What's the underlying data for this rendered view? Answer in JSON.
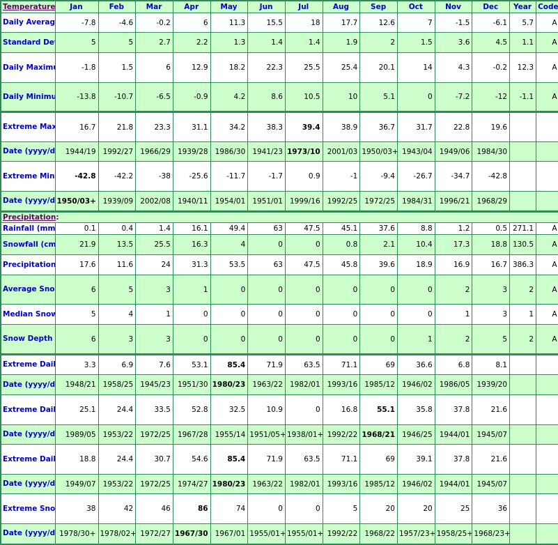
{
  "header": {
    "section_label": "Temperature",
    "section_suffix": ":",
    "months": [
      "Jan",
      "Feb",
      "Mar",
      "Apr",
      "May",
      "Jun",
      "Jul",
      "Aug",
      "Sep",
      "Oct",
      "Nov",
      "Dec"
    ],
    "year": "Year",
    "code": "Code"
  },
  "colors": {
    "border": "#2e8b57",
    "green_row": "#ccffcc",
    "label_text": "#0000cc",
    "section_text": "#660066"
  },
  "temperature": {
    "rows": [
      {
        "label": "Daily Average (°C)",
        "values": [
          "-7.8",
          "-4.6",
          "-0.2",
          "6",
          "11.3",
          "15.5",
          "18",
          "17.7",
          "12.6",
          "7",
          "-1.5",
          "-6.1"
        ],
        "year": "5.7",
        "code": "A",
        "bold": []
      },
      {
        "label": "Standard Deviation",
        "values": [
          "5",
          "5",
          "2.7",
          "2.2",
          "1.3",
          "1.4",
          "1.4",
          "1.9",
          "2",
          "1.5",
          "3.6",
          "4.5"
        ],
        "year": "1.1",
        "code": "A",
        "bold": []
      },
      {
        "label": "Daily Maximum (°C)",
        "values": [
          "-1.8",
          "1.5",
          "6",
          "12.9",
          "18.2",
          "22.3",
          "25.5",
          "25.4",
          "20.1",
          "14",
          "4.3",
          "-0.2"
        ],
        "year": "12.3",
        "code": "A",
        "bold": []
      },
      {
        "label": "Daily Minimum (°C)",
        "values": [
          "-13.8",
          "-10.7",
          "-6.5",
          "-0.9",
          "4.2",
          "8.6",
          "10.5",
          "10",
          "5.1",
          "0",
          "-7.2",
          "-12"
        ],
        "year": "-1.1",
        "code": "A",
        "bold": []
      },
      {
        "label": "Extreme Maximum (°C)",
        "values": [
          "16.7",
          "21.8",
          "23.3",
          "31.1",
          "34.2",
          "38.3",
          "39.4",
          "38.9",
          "36.7",
          "31.7",
          "22.8",
          "19.6"
        ],
        "year": "",
        "code": "",
        "bold": [
          6
        ]
      },
      {
        "label": "Date (yyyy/dd)",
        "values": [
          "1944/19",
          "1992/27",
          "1966/29",
          "1939/28",
          "1986/30",
          "1941/23",
          "1973/10",
          "2001/03",
          "1950/03+",
          "1943/04",
          "1949/06",
          "1984/30"
        ],
        "year": "",
        "code": "",
        "bold": [
          6
        ]
      },
      {
        "label": "Extreme Minimum (°C)",
        "values": [
          "-42.8",
          "-42.2",
          "-38",
          "-25.6",
          "-11.7",
          "-1.7",
          "0.9",
          "-1",
          "-9.4",
          "-26.7",
          "-34.7",
          "-42.8"
        ],
        "year": "",
        "code": "",
        "bold": [
          0
        ]
      },
      {
        "label": "Date (yyyy/dd)",
        "values": [
          "1950/03+",
          "1939/09",
          "2002/08",
          "1940/11",
          "1954/01",
          "1951/01",
          "1999/16",
          "1992/25",
          "1972/25",
          "1984/31",
          "1996/21",
          "1968/29"
        ],
        "year": "",
        "code": "",
        "bold": [
          0
        ]
      }
    ]
  },
  "precipitation": {
    "section_label": "Precipitation",
    "section_suffix": ":",
    "rows": [
      {
        "label": "Rainfall (mm)",
        "values": [
          "0.1",
          "0.4",
          "1.4",
          "16.1",
          "49.4",
          "63",
          "47.5",
          "45.1",
          "37.6",
          "8.8",
          "1.2",
          "0.5"
        ],
        "year": "271.1",
        "code": "A",
        "bold": []
      },
      {
        "label": "Snowfall (cm)",
        "values": [
          "21.9",
          "13.5",
          "25.5",
          "16.3",
          "4",
          "0",
          "0",
          "0.8",
          "2.1",
          "10.4",
          "17.3",
          "18.8"
        ],
        "year": "130.5",
        "code": "A",
        "bold": []
      },
      {
        "label": "Precipitation (mm)",
        "values": [
          "17.6",
          "11.6",
          "24",
          "31.3",
          "53.5",
          "63",
          "47.5",
          "45.8",
          "39.6",
          "18.9",
          "16.9",
          "16.7"
        ],
        "year": "386.3",
        "code": "A",
        "bold": []
      },
      {
        "label": "Average Snow Depth (cm)",
        "values": [
          "6",
          "5",
          "3",
          "1",
          "0",
          "0",
          "0",
          "0",
          "0",
          "0",
          "2",
          "3"
        ],
        "year": "2",
        "code": "A",
        "bold": []
      },
      {
        "label": "Median Snow Depth (cm)",
        "values": [
          "5",
          "4",
          "1",
          "0",
          "0",
          "0",
          "0",
          "0",
          "0",
          "0",
          "1",
          "3"
        ],
        "year": "1",
        "code": "A",
        "bold": []
      },
      {
        "label": "Snow Depth at Month-end (cm)",
        "values": [
          "6",
          "3",
          "3",
          "0",
          "0",
          "0",
          "0",
          "0",
          "0",
          "1",
          "2",
          "5"
        ],
        "year": "2",
        "code": "A",
        "bold": []
      },
      {
        "label": "Extreme Daily Rainfall (mm)",
        "values": [
          "3.3",
          "6.9",
          "7.6",
          "53.1",
          "85.4",
          "71.9",
          "63.5",
          "71.1",
          "69",
          "36.6",
          "6.8",
          "8.1"
        ],
        "year": "",
        "code": "",
        "bold": [
          4
        ]
      },
      {
        "label": "Date (yyyy/dd)",
        "values": [
          "1948/21",
          "1958/25",
          "1945/23",
          "1951/30",
          "1980/23",
          "1963/22",
          "1982/01",
          "1993/16",
          "1985/12",
          "1946/02",
          "1986/05",
          "1939/20"
        ],
        "year": "",
        "code": "",
        "bold": [
          4
        ]
      },
      {
        "label": "Extreme Daily Snowfall (cm)",
        "values": [
          "25.1",
          "24.4",
          "33.5",
          "52.8",
          "32.5",
          "10.9",
          "0",
          "16.8",
          "55.1",
          "35.8",
          "37.8",
          "21.6"
        ],
        "year": "",
        "code": "",
        "bold": [
          8
        ]
      },
      {
        "label": "Date (yyyy/dd)",
        "values": [
          "1989/05",
          "1953/22",
          "1972/25",
          "1967/28",
          "1955/14",
          "1951/05+",
          "1938/01+",
          "1992/22",
          "1968/21",
          "1946/25",
          "1944/01",
          "1945/07"
        ],
        "year": "",
        "code": "",
        "bold": [
          8
        ]
      },
      {
        "label": "Extreme Daily Precipitation (mm)",
        "values": [
          "18.8",
          "24.4",
          "30.7",
          "54.6",
          "85.4",
          "71.9",
          "63.5",
          "71.1",
          "69",
          "39.1",
          "37.8",
          "21.6"
        ],
        "year": "",
        "code": "",
        "bold": [
          4
        ]
      },
      {
        "label": "Date (yyyy/dd)",
        "values": [
          "1949/07",
          "1953/22",
          "1972/25",
          "1974/27",
          "1980/23",
          "1963/22",
          "1982/01",
          "1993/16",
          "1985/12",
          "1946/02",
          "1944/01",
          "1945/07"
        ],
        "year": "",
        "code": "",
        "bold": [
          4
        ]
      },
      {
        "label": "Extreme Snow Depth (cm)",
        "values": [
          "38",
          "42",
          "46",
          "86",
          "74",
          "0",
          "0",
          "5",
          "20",
          "20",
          "25",
          "36"
        ],
        "year": "",
        "code": "",
        "bold": [
          3
        ]
      },
      {
        "label": "Date (yyyy/dd)",
        "values": [
          "1978/30+",
          "1978/02+",
          "1972/27",
          "1967/30",
          "1967/01",
          "1955/01+",
          "1955/01+",
          "1992/22",
          "1968/22",
          "1957/23+",
          "1958/25+",
          "1968/23+"
        ],
        "year": "",
        "code": "",
        "bold": [
          3
        ]
      }
    ]
  }
}
